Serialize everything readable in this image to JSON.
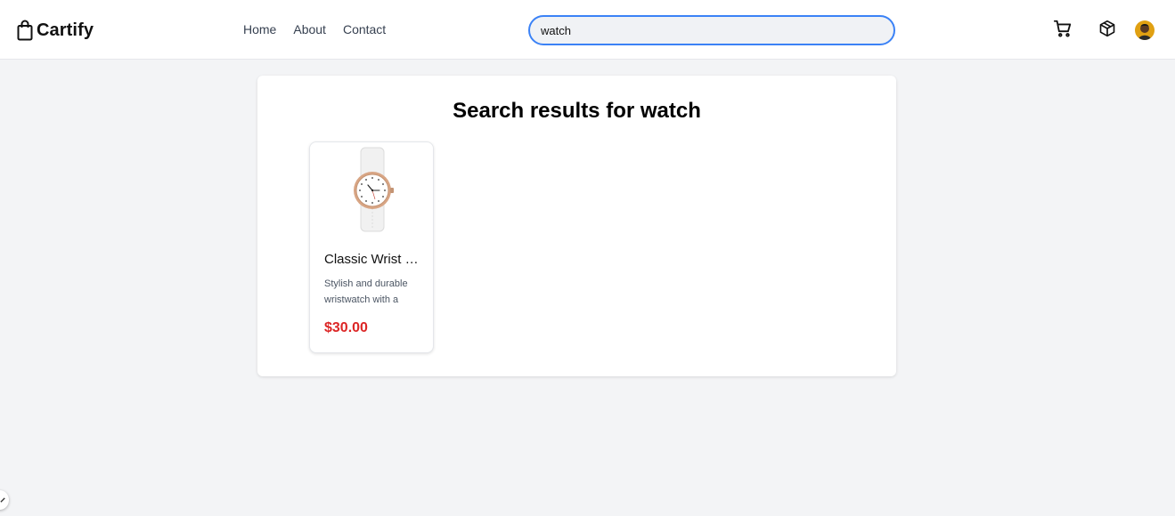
{
  "header": {
    "brand": "Cartify",
    "nav": [
      "Home",
      "About",
      "Contact"
    ],
    "search": {
      "value": "watch"
    },
    "icons": [
      "shopping-bag-icon",
      "cart-icon",
      "box-icon",
      "avatar"
    ]
  },
  "main": {
    "title": "Search results for watch",
    "products": [
      {
        "title": "Classic Wrist Watch",
        "description": "Stylish and durable wristwatch with a",
        "price": "$30.00"
      }
    ]
  },
  "colors": {
    "accent": "#3b82f6",
    "price": "#dc2626",
    "background": "#f3f4f6"
  }
}
